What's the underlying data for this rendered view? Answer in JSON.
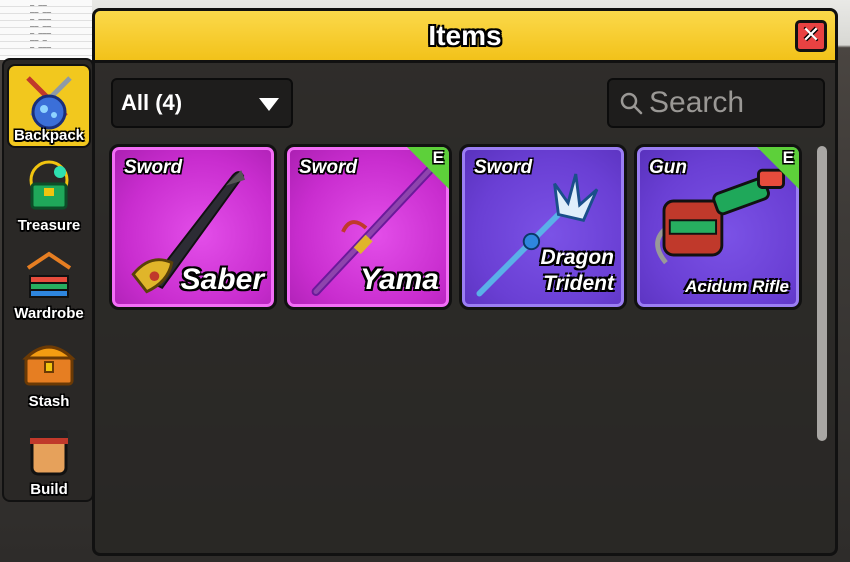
{
  "sidebar": {
    "items": [
      {
        "label": "Backpack",
        "icon": "backpack-icon",
        "active": true
      },
      {
        "label": "Treasure",
        "icon": "treasure-icon",
        "active": false
      },
      {
        "label": "Wardrobe",
        "icon": "wardrobe-icon",
        "active": false
      },
      {
        "label": "Stash",
        "icon": "stash-chest-icon",
        "active": false
      },
      {
        "label": "Build",
        "icon": "build-avatar-icon",
        "active": false
      }
    ]
  },
  "panel": {
    "title": "Items",
    "close_icon": "close-icon",
    "filter": {
      "selected": "All (4)"
    },
    "search": {
      "placeholder": "Search",
      "value": ""
    }
  },
  "items": [
    {
      "type": "Sword",
      "name": "Saber",
      "rarity_color": "#c92dcf",
      "equipped": false,
      "equip_label": ""
    },
    {
      "type": "Sword",
      "name": "Yama",
      "rarity_color": "#c92dcf",
      "equipped": true,
      "equip_label": "E"
    },
    {
      "type": "Sword",
      "name": "Dragon Trident",
      "name_line1": "Dragon",
      "name_line2": "Trident",
      "rarity_color": "#6a3fd4",
      "equipped": false,
      "equip_label": ""
    },
    {
      "type": "Gun",
      "name": "Acidum Rifle",
      "rarity_color": "#6a3fd4",
      "equipped": true,
      "equip_label": "E"
    }
  ],
  "colors": {
    "header": "#f2c21a",
    "close": "#e84242",
    "equip_badge": "#5dd03a",
    "mythical": "#c92dcf",
    "legendary": "#6a3fd4"
  }
}
